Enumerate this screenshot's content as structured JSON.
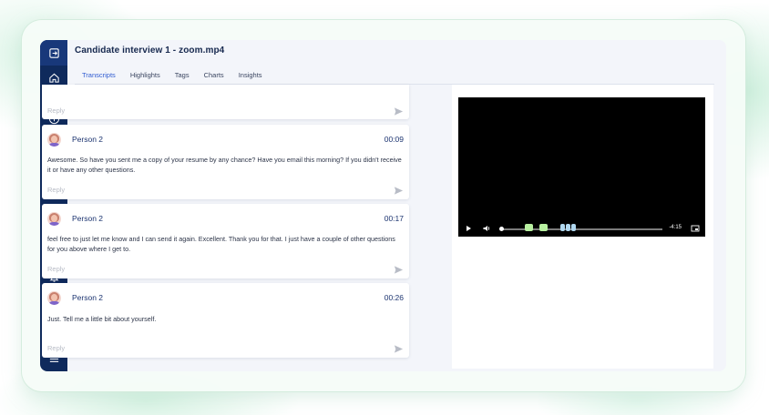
{
  "app": {
    "title": "Candidate interview 1 - zoom.mp4"
  },
  "tabs": [
    {
      "label": "Transcripts",
      "active": true
    },
    {
      "label": "Highlights",
      "active": false
    },
    {
      "label": "Tags",
      "active": false
    },
    {
      "label": "Charts",
      "active": false
    },
    {
      "label": "Insights",
      "active": false
    }
  ],
  "sidebar": {
    "top_icons": [
      "logout-icon",
      "home-icon",
      "users-icon",
      "upload-icon",
      "video-icon",
      "folder-icon"
    ],
    "bottom_icons": [
      "search-icon",
      "bell-icon",
      "add-user-icon",
      "help-icon",
      "avatar",
      "menu-icon"
    ]
  },
  "transcript": {
    "reply_placeholder": "Reply",
    "entries": [
      {
        "speaker": "Person 2",
        "time": "00:09",
        "text": "Awesome. So have you sent me a copy of your resume by any chance? Have you email this morning? If you didn't receive it or have any other questions."
      },
      {
        "speaker": "Person 2",
        "time": "00:17",
        "text": "feel free to just let me know and I can send it again. Excellent. Thank you for that. I just have a couple of other questions for you above where I get to."
      },
      {
        "speaker": "Person 2",
        "time": "00:26",
        "text": "Just. Tell me a little bit about yourself."
      }
    ]
  },
  "video": {
    "duration": "-4:15",
    "progress": 0.0,
    "marker_colors": [
      "#b8f0a0",
      "#b8f0a0",
      "#b0d8f0",
      "#b0d8f0",
      "#b0d8f0"
    ]
  },
  "colors": {
    "sidebar": "#0f2a5c",
    "accent": "#2f5bd1",
    "text_dark": "#1c3470"
  }
}
